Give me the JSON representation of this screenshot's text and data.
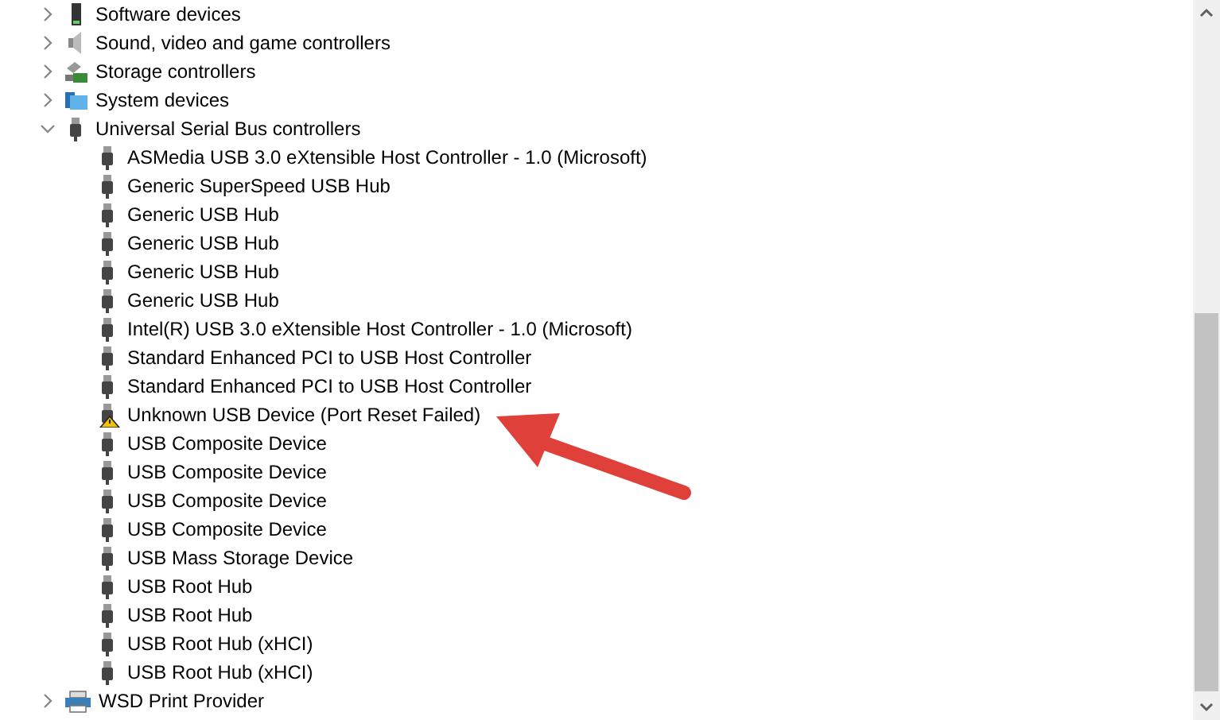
{
  "tree": [
    {
      "label": "Software devices",
      "kind": "software",
      "expanded": false
    },
    {
      "label": "Sound, video and game controllers",
      "kind": "sound",
      "expanded": false
    },
    {
      "label": "Storage controllers",
      "kind": "storage",
      "expanded": false
    },
    {
      "label": "System devices",
      "kind": "system",
      "expanded": false
    },
    {
      "label": "Universal Serial Bus controllers",
      "kind": "usb",
      "expanded": true,
      "children": [
        {
          "label": "ASMedia USB 3.0 eXtensible Host Controller - 1.0 (Microsoft)",
          "kind": "usb",
          "warning": false
        },
        {
          "label": "Generic SuperSpeed USB Hub",
          "kind": "usb",
          "warning": false
        },
        {
          "label": "Generic USB Hub",
          "kind": "usb",
          "warning": false
        },
        {
          "label": "Generic USB Hub",
          "kind": "usb",
          "warning": false
        },
        {
          "label": "Generic USB Hub",
          "kind": "usb",
          "warning": false
        },
        {
          "label": "Generic USB Hub",
          "kind": "usb",
          "warning": false
        },
        {
          "label": "Intel(R) USB 3.0 eXtensible Host Controller - 1.0 (Microsoft)",
          "kind": "usb",
          "warning": false
        },
        {
          "label": "Standard Enhanced PCI to USB Host Controller",
          "kind": "usb",
          "warning": false
        },
        {
          "label": "Standard Enhanced PCI to USB Host Controller",
          "kind": "usb",
          "warning": false
        },
        {
          "label": "Unknown USB Device (Port Reset Failed)",
          "kind": "usb",
          "warning": true
        },
        {
          "label": "USB Composite Device",
          "kind": "usb",
          "warning": false
        },
        {
          "label": "USB Composite Device",
          "kind": "usb",
          "warning": false
        },
        {
          "label": "USB Composite Device",
          "kind": "usb",
          "warning": false
        },
        {
          "label": "USB Composite Device",
          "kind": "usb",
          "warning": false
        },
        {
          "label": "USB Mass Storage Device",
          "kind": "usb",
          "warning": false
        },
        {
          "label": "USB Root Hub",
          "kind": "usb",
          "warning": false
        },
        {
          "label": "USB Root Hub",
          "kind": "usb",
          "warning": false
        },
        {
          "label": "USB Root Hub (xHCI)",
          "kind": "usb",
          "warning": false
        },
        {
          "label": "USB Root Hub (xHCI)",
          "kind": "usb",
          "warning": false
        }
      ]
    },
    {
      "label": "WSD Print Provider",
      "kind": "printer",
      "expanded": false
    }
  ]
}
